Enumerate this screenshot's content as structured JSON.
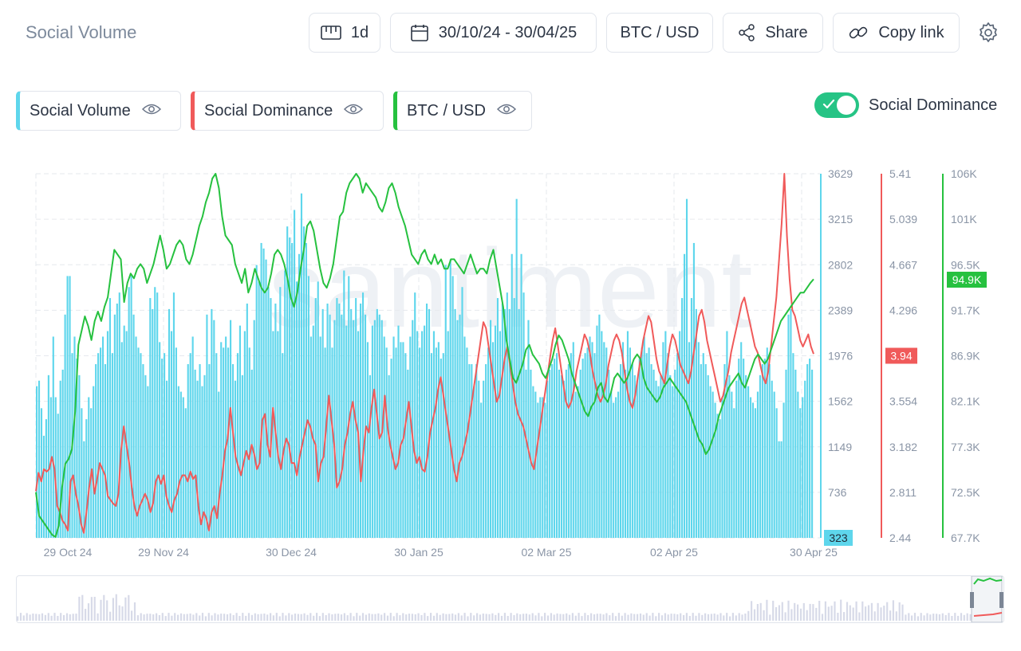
{
  "header": {
    "title": "Social Volume",
    "interval_label": "1d",
    "date_range": "30/10/24 - 30/04/25",
    "pair_label": "BTC / USD",
    "share_label": "Share",
    "copy_link_label": "Copy link"
  },
  "legend": [
    {
      "label": "Social Volume",
      "color": "#5ed6ec"
    },
    {
      "label": "Social Dominance",
      "color": "#f05a5a"
    },
    {
      "label": "BTC / USD",
      "color": "#26c13f"
    }
  ],
  "toggle": {
    "label": "Social Dominance",
    "on": true
  },
  "watermark": "santiment",
  "icons": {
    "interval": "ruler-icon",
    "date": "calendar-icon",
    "share": "share-icon",
    "copy": "link-icon",
    "settings": "gear-icon",
    "visibility": "eye-icon"
  },
  "chart_data": {
    "type": "bar+line",
    "x_ticks": [
      "29 Oct 24",
      "29 Nov 24",
      "30 Dec 24",
      "30 Jan 25",
      "02 Mar 25",
      "02 Apr 25",
      "30 Apr 25"
    ],
    "axes": {
      "social_volume": {
        "ticks": [
          "3629",
          "3215",
          "2802",
          "2389",
          "1976",
          "1562",
          "1149",
          "736",
          "323"
        ],
        "ylim": [
          323,
          3629
        ],
        "current": "323",
        "color": "#5ed6ec"
      },
      "social_dominance": {
        "ticks": [
          "5.41",
          "5.039",
          "4.667",
          "4.296",
          "3.94",
          "3.554",
          "3.182",
          "2.811",
          "2.44"
        ],
        "ylim": [
          2.44,
          5.41
        ],
        "current": "3.94",
        "color": "#f05a5a"
      },
      "btc_usd": {
        "ticks": [
          "106K",
          "101K",
          "96.5K",
          "91.7K",
          "86.9K",
          "82.1K",
          "77.3K",
          "72.5K",
          "67.7K"
        ],
        "ylim": [
          67700,
          106000
        ],
        "current": "94.9K",
        "color": "#26c13f"
      }
    },
    "series": [
      {
        "name": "Social Volume",
        "kind": "bar",
        "values": [
          1700,
          1750,
          1500,
          1250,
          1400,
          1800,
          1600,
          2150,
          1600,
          1450,
          1750,
          1850,
          2350,
          2700,
          2700,
          2000,
          2150,
          1950,
          1800,
          1500,
          1200,
          1400,
          1600,
          1500,
          1700,
          1900,
          2000,
          2050,
          2150,
          1900,
          2200,
          2500,
          2000,
          2350,
          2450,
          2550,
          2100,
          2250,
          2200,
          2600,
          2700,
          2350,
          2150,
          2050,
          2000,
          1900,
          1800,
          1700,
          2500,
          2400,
          2600,
          2550,
          2100,
          1950,
          2000,
          1750,
          2400,
          2200,
          2550,
          2050,
          1700,
          1650,
          1600,
          1500,
          1900,
          2000,
          2150,
          1850,
          1750,
          1900,
          1700,
          1800,
          2350,
          1900,
          2400,
          2300,
          2000,
          1650,
          2100,
          2050,
          2150,
          2050,
          2300,
          1900,
          1750,
          2000,
          2250,
          1800,
          2200,
          2450,
          2050,
          1850,
          2300,
          2800,
          2650,
          3000,
          2950,
          2850,
          2600,
          2500,
          2200,
          2450,
          2200,
          2600,
          2000,
          2750,
          3150,
          3050,
          3000,
          3300,
          2650,
          2900,
          3450,
          3150,
          3000,
          2700,
          2150,
          2250,
          2500,
          2650,
          2150,
          2400,
          2050,
          2450,
          2350,
          2050,
          2300,
          2500,
          2450,
          2350,
          2750,
          2250,
          2700,
          2400,
          2300,
          2500,
          2200,
          2450,
          2550,
          2350,
          2100,
          1800,
          2250,
          2300,
          2400,
          2350,
          2300,
          2150,
          2050,
          1800,
          1950,
          2150,
          2050,
          2250,
          2100,
          2100,
          2000,
          1850,
          2150,
          2300,
          2550,
          2200,
          2050,
          2200,
          2250,
          2450,
          2400,
          2000,
          2200,
          2050,
          2100,
          1950,
          2000,
          2800,
          2200,
          2850,
          2700,
          2400,
          2300,
          2350,
          2600,
          2150,
          2050,
          1900,
          1900,
          1700,
          1900,
          1750,
          1550,
          1750,
          1900,
          2050,
          2300,
          2100,
          2250,
          2500,
          2200,
          2450,
          2400,
          2550,
          2400,
          2900,
          2500,
          3400,
          2400,
          2900,
          2550,
          1850,
          2300,
          1850,
          1700,
          1650,
          1550,
          1600,
          1600,
          1550,
          1750,
          1850,
          1900,
          1950,
          2000,
          1850,
          1800,
          1750,
          1850,
          1900,
          2000,
          2100,
          1650,
          1700,
          1850,
          1950,
          2000,
          2050,
          2150,
          2100,
          2000,
          2250,
          2350,
          2200,
          2100,
          2050,
          1850,
          1650,
          1550,
          1600,
          1650,
          1900,
          2100,
          1850,
          2200,
          2050,
          1900,
          1800,
          1750,
          1950,
          2050,
          2150,
          2000,
          2050,
          1900,
          1850,
          1750,
          1700,
          1800,
          2100,
          2200,
          2000,
          1800,
          1700,
          1850,
          2000,
          2200,
          2500,
          2900,
          3400,
          2100,
          2500,
          3000,
          2400,
          2100,
          1900,
          2000,
          1900,
          1800,
          1700,
          1650,
          1550,
          1450,
          1400,
          1600,
          1900,
          2200,
          1800,
          1650,
          1500,
          1750,
          1950,
          2100,
          1950,
          1800,
          1700,
          1600,
          1550,
          1500,
          1650,
          1800,
          1900,
          1950,
          2050,
          1900,
          1750,
          1650,
          1500,
          1200,
          1200,
          1550,
          1850,
          2350,
          2400,
          2000,
          1850,
          1650,
          1500,
          1600,
          1750,
          1900,
          1950,
          1850
        ],
        "color": "#5ed6ec"
      },
      {
        "name": "Social Dominance",
        "kind": "line",
        "values": [
          2.82,
          2.97,
          2.9,
          3.0,
          2.98,
          3.0,
          3.1,
          3.0,
          2.7,
          2.65,
          2.58,
          2.55,
          2.5,
          2.9,
          2.95,
          2.8,
          2.7,
          2.55,
          2.48,
          2.65,
          2.85,
          3.0,
          2.8,
          2.92,
          3.05,
          3.0,
          2.95,
          2.78,
          2.75,
          2.72,
          2.7,
          2.8,
          3.15,
          3.35,
          3.2,
          3.05,
          2.85,
          2.7,
          2.62,
          2.7,
          2.75,
          2.8,
          2.75,
          2.65,
          2.72,
          2.9,
          2.95,
          2.88,
          2.95,
          2.78,
          2.7,
          2.65,
          2.75,
          2.8,
          2.9,
          2.95,
          2.95,
          2.9,
          2.98,
          2.92,
          2.95,
          2.7,
          2.55,
          2.65,
          2.6,
          2.5,
          2.65,
          2.7,
          2.6,
          2.8,
          2.95,
          3.15,
          3.25,
          3.5,
          3.3,
          3.1,
          3.02,
          2.95,
          3.05,
          3.15,
          3.08,
          3.2,
          3.12,
          3.0,
          3.05,
          3.4,
          3.45,
          3.2,
          3.1,
          3.5,
          3.3,
          3.1,
          3.0,
          3.15,
          3.25,
          3.2,
          3.05,
          3.05,
          2.95,
          3.1,
          3.2,
          3.3,
          3.4,
          3.35,
          3.25,
          3.2,
          2.9,
          3.05,
          3.1,
          3.35,
          3.6,
          3.4,
          3.2,
          2.85,
          2.9,
          3.0,
          3.2,
          3.3,
          3.45,
          3.55,
          3.4,
          3.3,
          2.9,
          3.15,
          3.35,
          3.3,
          3.5,
          3.65,
          3.45,
          3.25,
          3.3,
          3.6,
          3.35,
          3.2,
          3.1,
          3.0,
          3.05,
          3.2,
          3.25,
          3.4,
          3.55,
          3.35,
          3.15,
          3.05,
          3.1,
          3.0,
          2.98,
          3.1,
          3.3,
          3.4,
          3.5,
          3.65,
          3.75,
          3.6,
          3.45,
          3.3,
          3.15,
          3.0,
          2.9,
          3.05,
          3.1,
          3.2,
          3.3,
          3.45,
          3.6,
          3.75,
          3.9,
          4.05,
          4.2,
          4.15,
          4.0,
          3.85,
          3.7,
          3.55,
          3.6,
          3.75,
          3.9,
          4.0,
          3.85,
          3.7,
          3.55,
          3.45,
          3.4,
          3.35,
          3.25,
          3.15,
          3.05,
          3.0,
          3.15,
          3.3,
          3.45,
          3.6,
          3.75,
          3.9,
          4.05,
          4.15,
          4.0,
          3.85,
          3.7,
          3.55,
          3.5,
          3.55,
          3.65,
          3.8,
          3.9,
          4.0,
          4.1,
          4.05,
          3.95,
          3.8,
          3.7,
          3.6,
          3.55,
          3.6,
          3.7,
          3.85,
          3.95,
          4.05,
          4.1,
          4.05,
          3.95,
          3.8,
          3.65,
          3.55,
          3.5,
          3.6,
          3.75,
          3.9,
          4.05,
          4.15,
          4.25,
          4.2,
          4.05,
          3.9,
          3.8,
          3.75,
          3.7,
          3.85,
          4.0,
          4.1,
          4.05,
          3.95,
          3.85,
          3.8,
          3.75,
          3.7,
          3.8,
          3.95,
          4.1,
          4.25,
          4.3,
          4.2,
          4.05,
          3.95,
          3.85,
          3.75,
          3.65,
          3.55,
          3.6,
          3.7,
          3.8,
          3.95,
          4.05,
          4.15,
          4.25,
          4.35,
          4.4,
          4.3,
          4.2,
          4.1,
          4.0,
          3.95,
          3.85,
          3.75,
          3.7,
          3.8,
          4.0,
          4.2,
          4.4,
          4.7,
          5.0,
          5.41,
          4.9,
          4.55,
          4.3,
          4.25,
          4.15,
          4.05,
          4.0,
          4.05,
          4.1,
          4.0,
          3.94
        ]
      },
      {
        "name": "BTC / USD",
        "kind": "line",
        "values": [
          72500,
          70000,
          69500,
          69000,
          68500,
          68000,
          67800,
          69000,
          73000,
          75500,
          76000,
          77000,
          81000,
          88000,
          89500,
          91000,
          90000,
          88500,
          90500,
          91500,
          90500,
          92000,
          93000,
          95500,
          98000,
          97500,
          97000,
          92500,
          94500,
          95500,
          95000,
          96000,
          96500,
          96000,
          94500,
          95500,
          96500,
          98000,
          99500,
          98000,
          96000,
          96500,
          97500,
          98500,
          99000,
          98500,
          97000,
          96500,
          97500,
          99000,
          100500,
          101500,
          103000,
          104000,
          105500,
          106000,
          104500,
          101500,
          99500,
          99000,
          98500,
          96500,
          95500,
          94500,
          96000,
          93500,
          94500,
          96000,
          95000,
          94000,
          93500,
          94000,
          95500,
          97500,
          98000,
          97500,
          96500,
          95000,
          93000,
          92000,
          93500,
          96000,
          98000,
          100500,
          101000,
          100000,
          98000,
          96000,
          94500,
          94000,
          95000,
          96500,
          99000,
          101500,
          102000,
          104000,
          105000,
          105500,
          106000,
          105500,
          104000,
          105000,
          104500,
          104000,
          103500,
          102500,
          102000,
          103000,
          104500,
          105000,
          104000,
          102500,
          101500,
          100500,
          99000,
          97500,
          97000,
          96500,
          97500,
          98000,
          97000,
          96500,
          97500,
          96500,
          97000,
          96000,
          96000,
          97000,
          97000,
          96500,
          96000,
          95500,
          96500,
          97500,
          96500,
          95500,
          96000,
          96000,
          95500,
          97000,
          98000,
          96000,
          94000,
          92000,
          88500,
          86500,
          84500,
          84000,
          85000,
          86000,
          87500,
          88000,
          87000,
          86500,
          86000,
          85000,
          84500,
          85500,
          86500,
          88000,
          89000,
          88500,
          87500,
          86500,
          85000,
          84000,
          83000,
          82000,
          81000,
          80500,
          81500,
          82000,
          83500,
          84000,
          82500,
          82000,
          83000,
          84500,
          85000,
          84500,
          84000,
          84500,
          85500,
          86500,
          87000,
          86500,
          84500,
          83500,
          83000,
          82500,
          82000,
          82500,
          83500,
          84000,
          84500,
          84000,
          83500,
          83000,
          82500,
          82000,
          81000,
          80000,
          79000,
          78000,
          77500,
          76500,
          77000,
          78000,
          79000,
          80500,
          81500,
          82500,
          83500,
          84000,
          84500,
          85000,
          84000,
          83500,
          84500,
          85500,
          86500,
          87000,
          86500,
          86000,
          86500,
          87500,
          88500,
          89500,
          90500,
          91000,
          91500,
          92000,
          92500,
          93000,
          93500,
          93500,
          94000,
          94500,
          94900
        ]
      }
    ]
  }
}
